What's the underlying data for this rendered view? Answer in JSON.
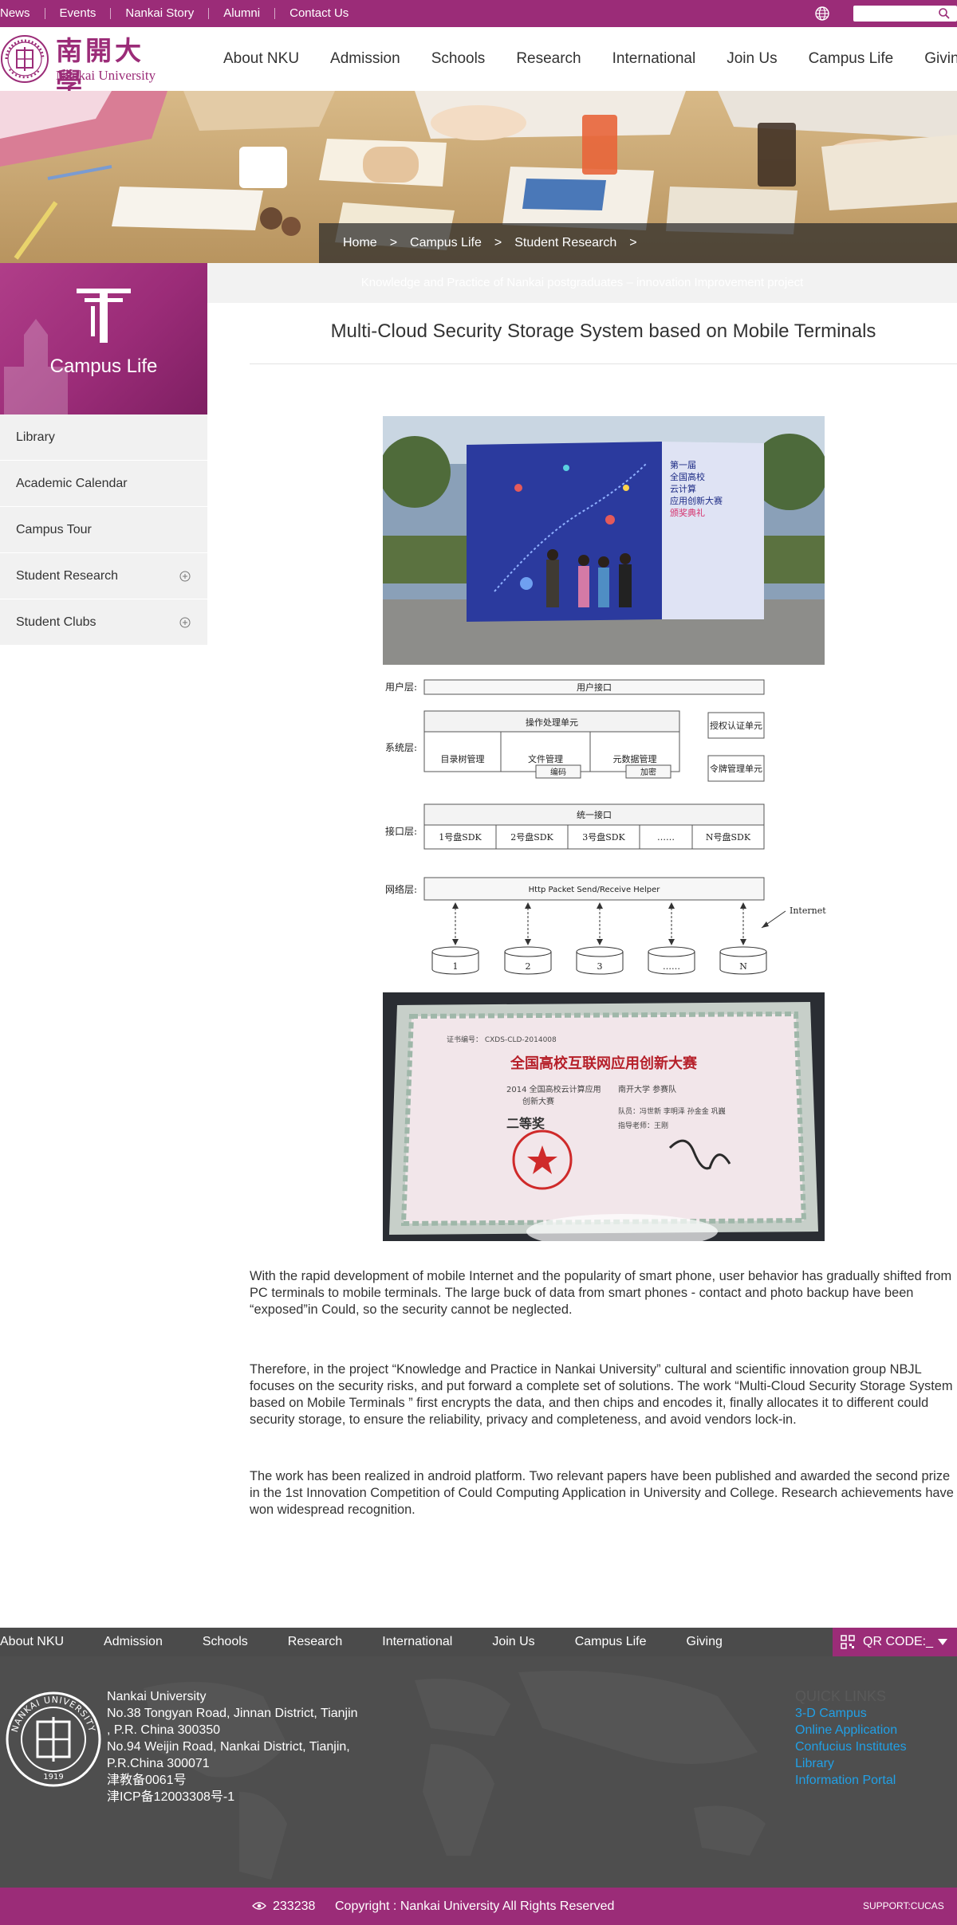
{
  "topbar": {
    "links": [
      "News",
      "Events",
      "Nankai Story",
      "Alumni",
      "Contact Us"
    ],
    "search_placeholder": "",
    "icons": [
      "globe-icon",
      "search-icon"
    ]
  },
  "logo": {
    "name_cn": "南開大學",
    "name_en": "Nankai University"
  },
  "main_nav": [
    "About NKU",
    "Admission",
    "Schools",
    "Research",
    "International",
    "Join Us",
    "Campus Life",
    "Giving"
  ],
  "breadcrumb": {
    "items": [
      "Home",
      "Campus Life",
      "Student Research"
    ],
    "separator": ">"
  },
  "sidebar": {
    "title": "Campus Life",
    "items": [
      {
        "label": "Library",
        "expandable": false
      },
      {
        "label": "Academic Calendar",
        "expandable": false
      },
      {
        "label": "Campus Tour",
        "expandable": false
      },
      {
        "label": "Student Research",
        "expandable": true
      },
      {
        "label": "Student Clubs",
        "expandable": true
      }
    ]
  },
  "content": {
    "subtitle": "Knowledge and Practice of Nankai postgraduates – innovation Improvement project",
    "title": "Multi-Cloud Security Storage System based on Mobile Terminals",
    "photo1": {
      "banner_lines": [
        "第一届",
        "全国高校",
        "云计算",
        "应用创新大赛",
        "颁奖典礼"
      ]
    },
    "diagram": {
      "layers": [
        "用户层:",
        "系统层:",
        "接口层:",
        "网络层:"
      ],
      "user_interface": "用户接口",
      "operation_unit": "操作处理单元",
      "system_modules": [
        "目录树管理",
        "文件管理",
        "元数据管理"
      ],
      "sub_modules": [
        "编码",
        "加密"
      ],
      "side_units": [
        "授权认证单元",
        "令牌管理单元"
      ],
      "unified_interface": "统一接口",
      "sdks": [
        "1号盘SDK",
        "2号盘SDK",
        "3号盘SDK",
        "……",
        "N号盘SDK"
      ],
      "network_helper": "Http Packet Send/Receive Helper",
      "internet_label": "Internet",
      "disks": [
        "1",
        "2",
        "3",
        "……",
        "N"
      ]
    },
    "photo2": {
      "certificate_no": "证书编号：  CXDS-CLD-2014008",
      "certificate_title": "全国高校互联网应用创新大赛",
      "certificate_lines": [
        "2014 全国高校云计算应用",
        "创新大赛"
      ],
      "certificate_prize": "二等奖",
      "certificate_school": "南开大学  参赛队",
      "certificate_members": "队员：冯世新  李明泽  孙金金  巩巍",
      "certificate_advisor": "指导老师：王刚"
    },
    "paragraphs": [
      "With the rapid development of mobile Internet and the popularity of smart phone, user behavior has gradually shifted from PC terminals to mobile terminals. The large buck of data from smart phones - contact and photo backup have been “exposed”in Could, so the security cannot be neglected.",
      "Therefore, in the project “Knowledge and Practice in Nankai University” cultural and scientific innovation group NBJL focuses on the security risks, and put forward a complete set of solutions. The work “Multi-Cloud Security Storage System based on Mobile Terminals ” first encrypts the data, and then chips and encodes it, finally allocates it to different could security storage, to ensure the reliability, privacy and completeness, and avoid vendors lock-in.",
      "The work has been realized in android platform. Two relevant papers have been published and awarded the second prize in the 1st Innovation Competition of Could Computing Application in University and College. Research achievements have won widespread recognition."
    ]
  },
  "footer": {
    "nav": [
      "About NKU",
      "Admission",
      "Schools",
      "Research",
      "International",
      "Join Us",
      "Campus Life",
      "Giving"
    ],
    "qr_label": "QR CODE:_",
    "seal_text": "NANKAI UNIVERSITY",
    "seal_year": "1919",
    "address_lines": [
      "Nankai University",
      "No.38 Tongyan Road, Jinnan District, Tianjin",
      ", P.R. China 300350",
      "No.94 Weijin Road,  Nankai District, Tianjin,",
      "P.R.China  300071",
      "津教备0061号",
      "津ICP备12003308号-1"
    ],
    "quick_links_title": "QUICK LINKS",
    "quick_links": [
      "3-D Campus",
      "Online Application",
      "Confucius Institutes",
      "Library",
      "Information Portal"
    ],
    "visit_count": "233238",
    "copyright": "Copyright : Nankai University All Rights Reserved",
    "support": "SUPPORT:CUCAS"
  },
  "colors": {
    "brand_purple": "#9b2c78",
    "footer_gray": "#4b4b4b",
    "quick_link_blue": "#21a0e6",
    "sidebar_bg": "#f1f1f1"
  }
}
